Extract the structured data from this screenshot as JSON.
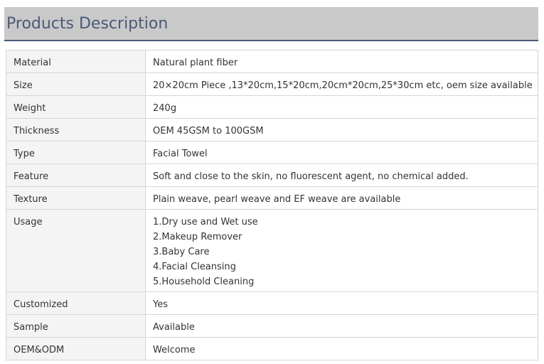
{
  "header": {
    "title": "Products Description"
  },
  "rows": [
    {
      "key": "Material",
      "value": "Natural plant fiber"
    },
    {
      "key": "Size",
      "value": "20×20cm Piece ,13*20cm,15*20cm,20cm*20cm,25*30cm etc, oem size available"
    },
    {
      "key": "Weight",
      "value": "240g"
    },
    {
      "key": "Thickness",
      "value": "OEM 45GSM to 100GSM"
    },
    {
      "key": "Type",
      "value": "Facial Towel"
    },
    {
      "key": "Feature",
      "value": "Soft and close to the skin, no fluorescent agent, no chemical added."
    },
    {
      "key": "Texture",
      "value": "Plain weave, pearl weave and EF weave are available"
    },
    {
      "key": "Usage",
      "lines": [
        "1.Dry use and Wet use",
        "2.Makeup Remover",
        "3.Baby Care",
        "4.Facial Cleansing",
        "5.Household Cleaning"
      ]
    },
    {
      "key": "Customized",
      "value": "Yes"
    },
    {
      "key": "Sample",
      "value": "Available"
    },
    {
      "key": "OEM&ODM",
      "value": "Welcome"
    }
  ]
}
